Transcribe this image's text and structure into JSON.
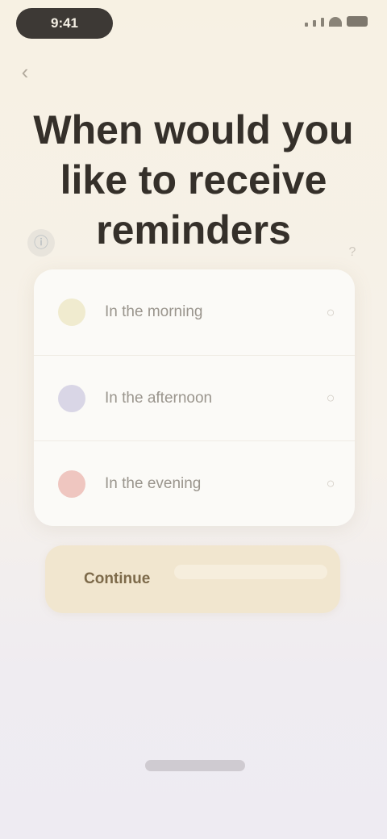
{
  "status_bar": {
    "time": "9:41",
    "icons": [
      "signal-icon",
      "wifi-icon",
      "battery-icon"
    ]
  },
  "header": {
    "back_icon": "back-arrow-icon",
    "title": "When would you like to receive reminders"
  },
  "helper_icons": [
    "info-icon",
    "help-icon"
  ],
  "options": [
    {
      "label": "In the morning",
      "icon": "sunrise-icon",
      "color": "#f0ebcf",
      "selected": false
    },
    {
      "label": "In the afternoon",
      "icon": "clock-icon",
      "color": "#d9d6e6",
      "selected": false
    },
    {
      "label": "In the evening",
      "icon": "moon-icon",
      "color": "#efc6c0",
      "selected": false
    }
  ],
  "primary_action": {
    "label": "Continue"
  },
  "colors": {
    "background_top": "#f7f1e3",
    "background_bottom": "#eeebf2",
    "card": "#fbfaf7",
    "cta": "#f1e6cf",
    "title": "#35302a"
  }
}
